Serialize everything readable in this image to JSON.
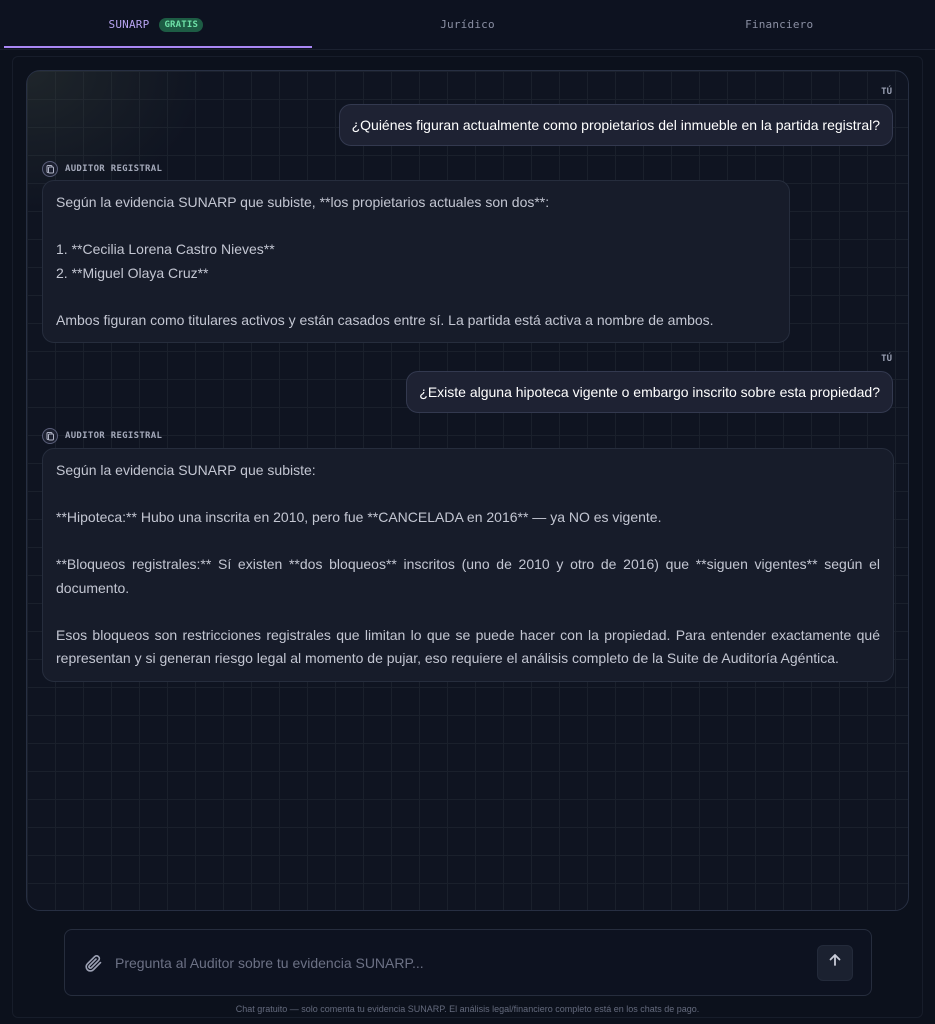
{
  "tabs": [
    {
      "label": "SUNARP",
      "badge": "GRATIS",
      "active": true
    },
    {
      "label": "Jurídico",
      "active": false
    },
    {
      "label": "Financiero",
      "active": false
    }
  ],
  "chat": {
    "user_role": "TÚ",
    "bot_role": "AUDITOR REGISTRAL",
    "messages": [
      {
        "role": "user",
        "text": "¿Quiénes figuran actualmente como propietarios del inmueble en la partida registral?"
      },
      {
        "role": "bot",
        "paragraphs": [
          "Según la evidencia SUNARP que subiste, **los propietarios actuales son dos**:",
          "1. **Cecilia Lorena Castro Nieves**",
          "2. **Miguel Olaya Cruz**",
          "Ambos figuran como titulares activos y están casados entre sí. La partida está activa a nombre de ambos."
        ]
      },
      {
        "role": "user",
        "text": "¿Existe alguna hipoteca vigente o embargo inscrito sobre esta propiedad?"
      },
      {
        "role": "bot",
        "paragraphs": [
          "Según la evidencia SUNARP que subiste:",
          "**Hipoteca:** Hubo una inscrita en 2010, pero fue **CANCELADA en 2016** — ya NO es vigente.",
          "**Bloqueos registrales:** Sí existen **dos bloqueos** inscritos (uno de 2010 y otro de 2016) que **siguen vigentes** según el documento.",
          "Esos bloqueos son restricciones registrales que limitan lo que se puede hacer con la propiedad. Para entender exactamente qué representan y si generan riesgo legal al momento de pujar, eso requiere el análisis completo de la Suite de Auditoría Agéntica."
        ]
      }
    ]
  },
  "input": {
    "placeholder": "Pregunta al Auditor sobre tu evidencia SUNARP...",
    "value": ""
  },
  "footer": "Chat gratuito — solo comenta tu evidencia SUNARP. El análisis legal/financiero completo está en los chats de pago.",
  "colors": {
    "accent": "#a987f5",
    "badge_bg": "#1d5c44",
    "badge_text": "#6ee2a8"
  }
}
